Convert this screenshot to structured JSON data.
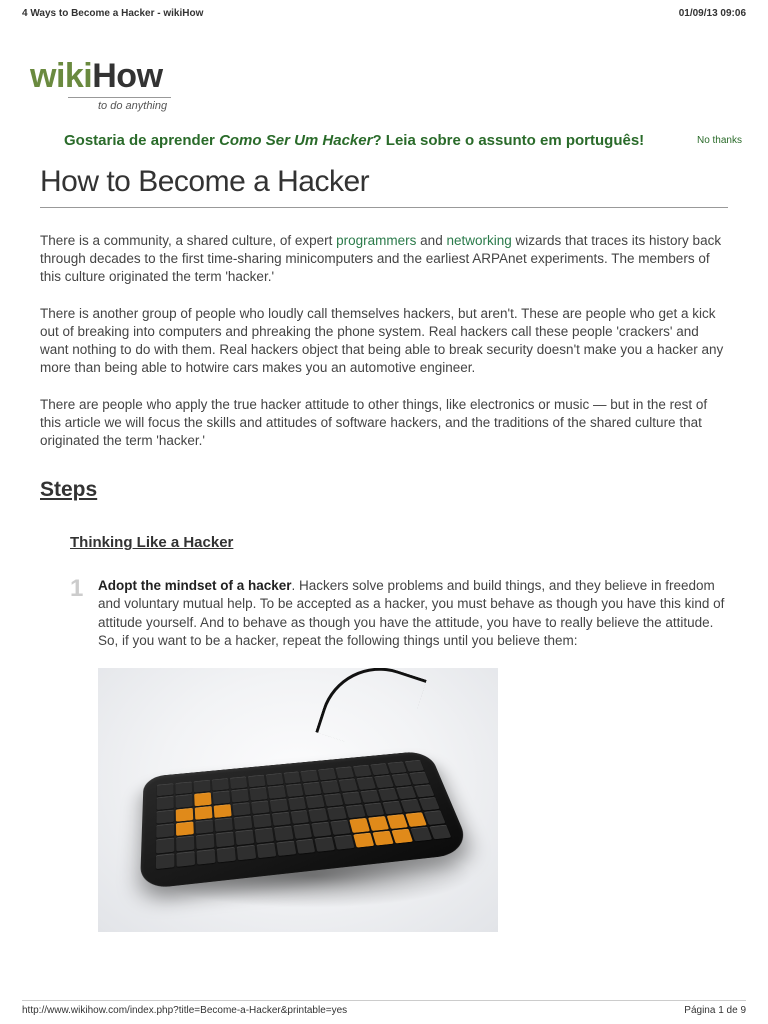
{
  "header": {
    "title": "4 Ways to Become a Hacker - wikiHow",
    "datetime": "01/09/13 09:06"
  },
  "logo": {
    "part1": "wiki",
    "part2": "How",
    "tagline": "to do anything"
  },
  "banner": {
    "prefix": "Gostaria de aprender ",
    "italic": "Como Ser Um Hacker",
    "suffix": "? Leia sobre o assunto em português!",
    "no_thanks": "No thanks"
  },
  "title": "How to Become a Hacker",
  "intro": {
    "p1a": "There is a community, a shared culture, of expert ",
    "link1": "programmers",
    "p1b": " and ",
    "link2": "networking",
    "p1c": " wizards that traces its history back through decades to the first time-sharing minicomputers and the earliest ARPAnet experiments. The members of this culture originated the term 'hacker.'",
    "p2": "There is another group of people who loudly call themselves hackers, but aren't. These are people who get a kick out of breaking into computers and phreaking the phone system. Real hackers call these people 'crackers' and want nothing to do with them. Real hackers object that being able to break security doesn't make you a hacker any more than being able to hotwire cars makes you an automotive engineer.",
    "p3": "There are people who apply the true hacker attitude to other things, like electronics or music — but in the rest of this article we will focus the skills and attitudes of software hackers, and the traditions of the shared culture that originated the term 'hacker.'"
  },
  "steps_heading": "Steps",
  "subsection": "Thinking Like a Hacker",
  "step1": {
    "num": "1",
    "bold": "Adopt the mindset of a hacker",
    "rest": ". Hackers solve problems and build things, and they believe in freedom and voluntary mutual help. To be accepted as a hacker, you must behave as though you have this kind of attitude yourself. And to behave as though you have the attitude, you have to really believe the attitude. So, if you want to be a hacker, repeat the following things until you believe them:"
  },
  "footer": {
    "url": "http://www.wikihow.com/index.php?title=Become-a-Hacker&printable=yes",
    "page": "Página 1 de 9"
  }
}
